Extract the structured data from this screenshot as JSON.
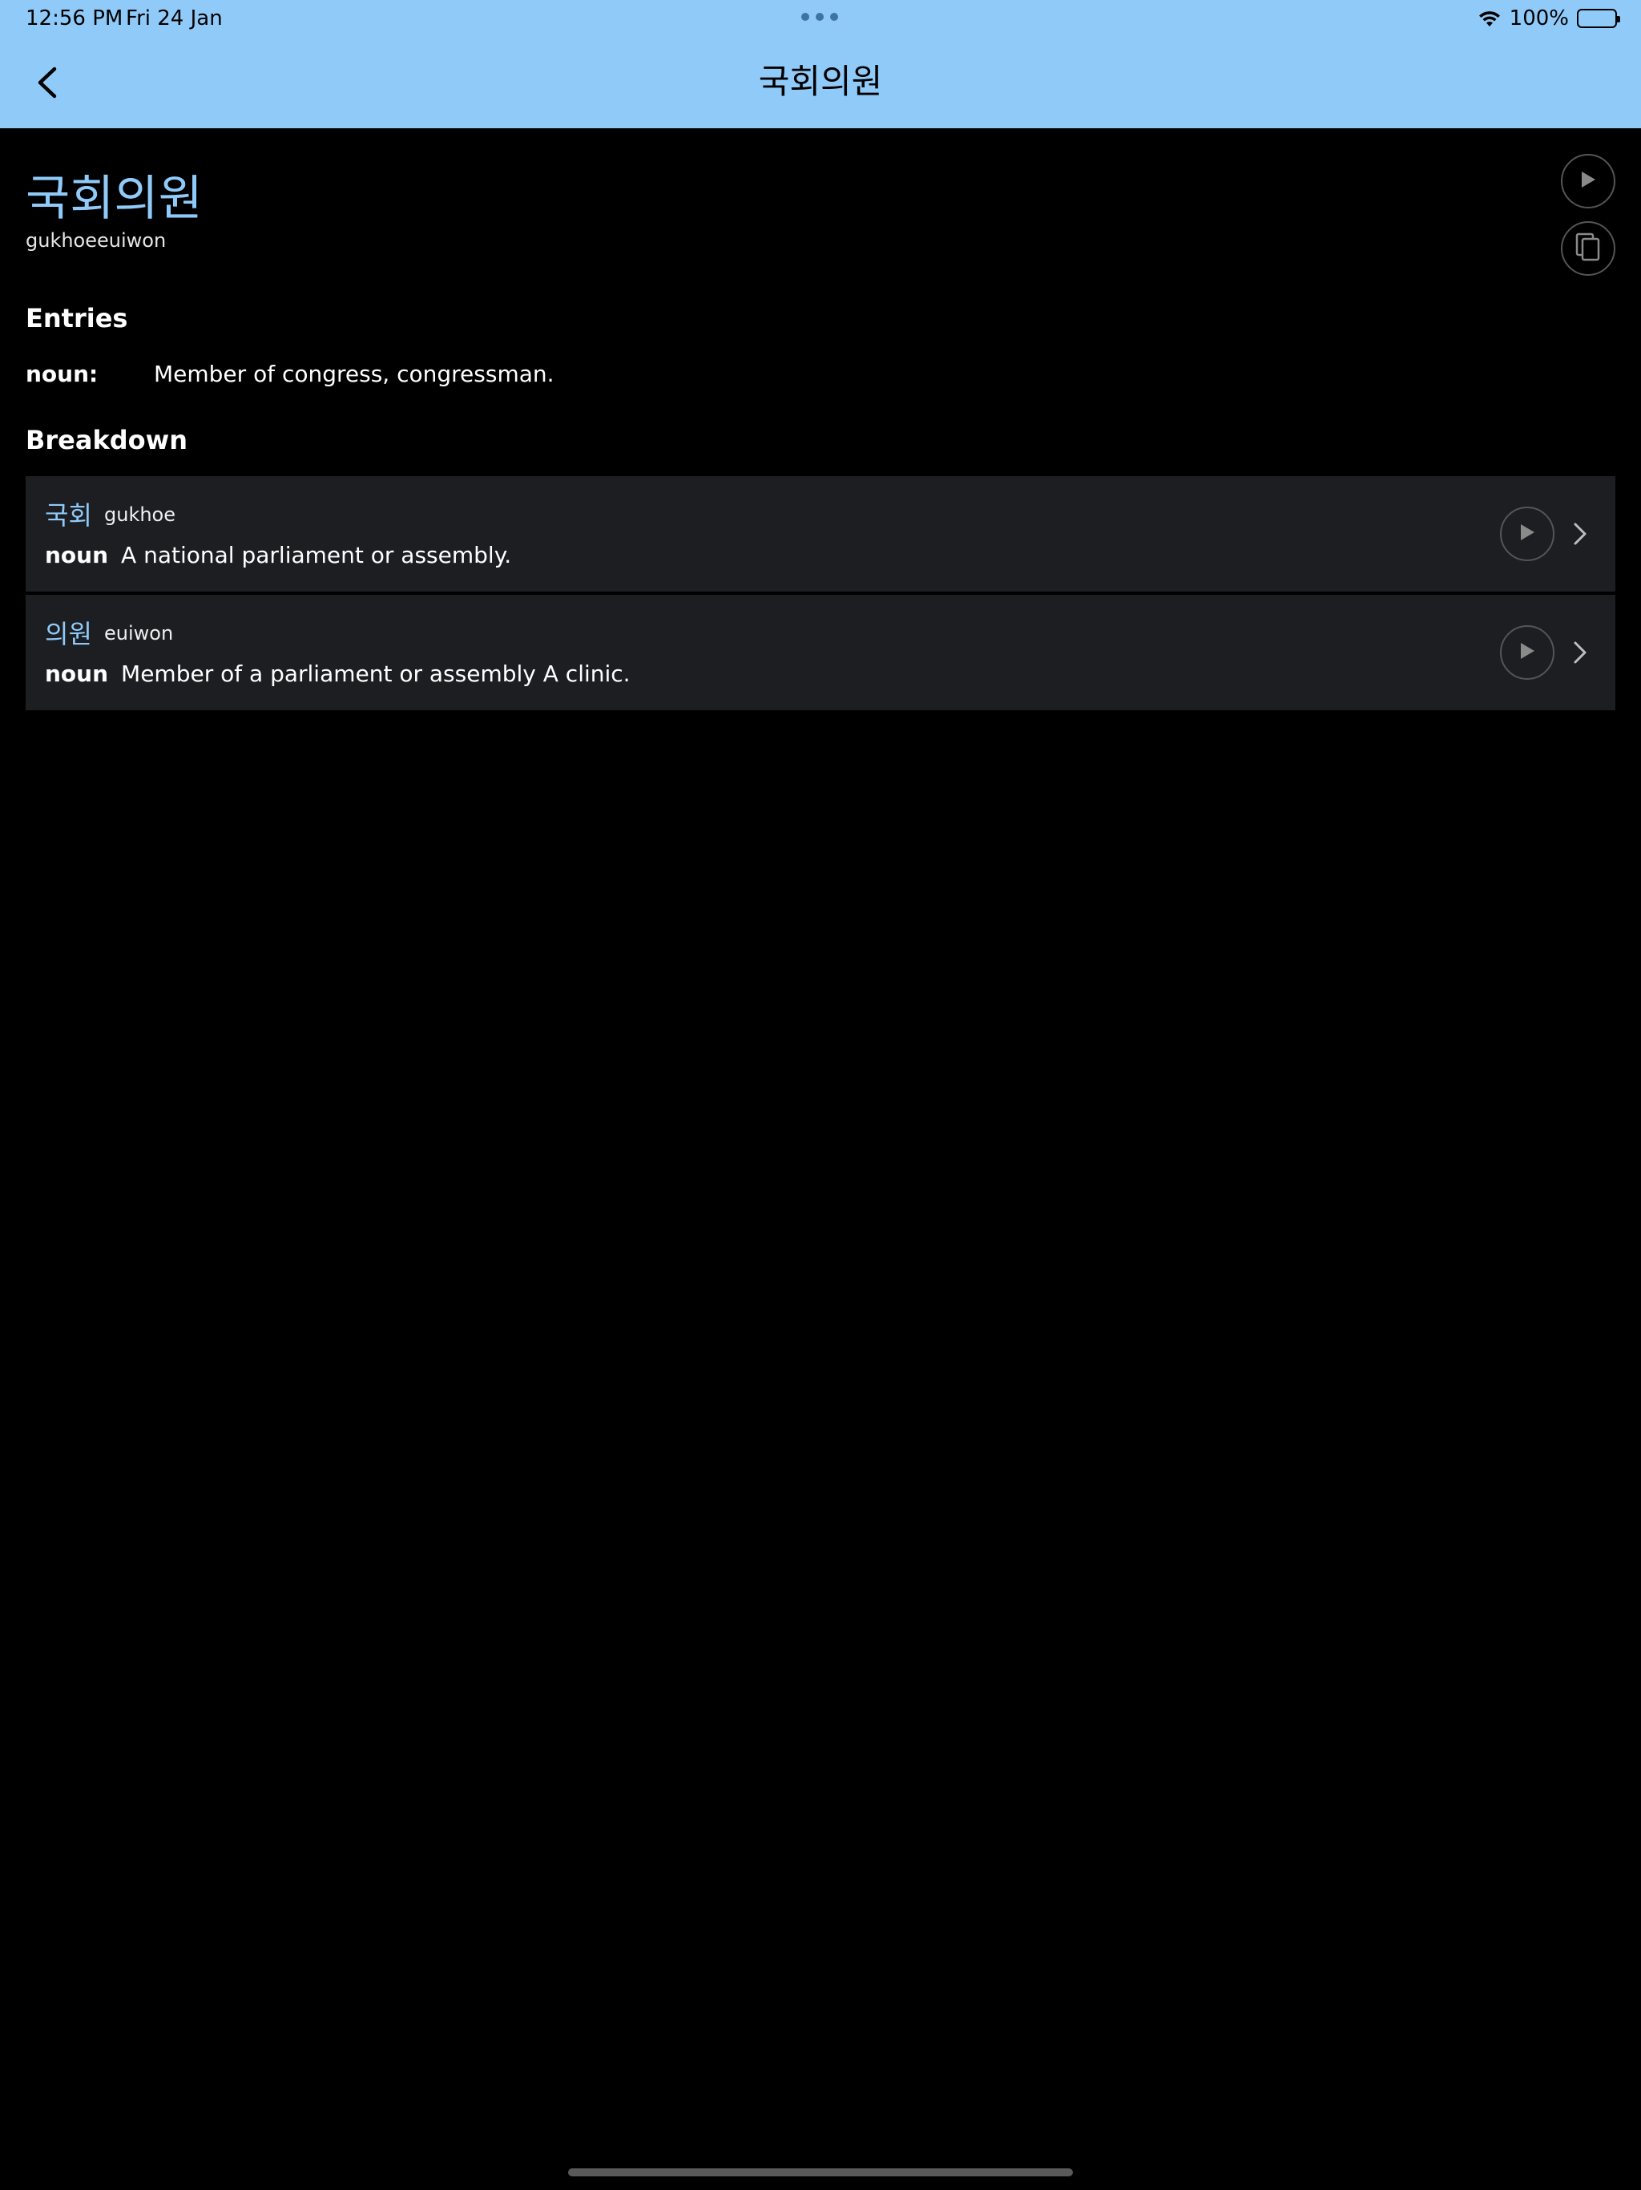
{
  "status_bar": {
    "time": "12:56 PM",
    "date": "Fri 24 Jan",
    "battery": "100%"
  },
  "nav": {
    "title": "국회의원"
  },
  "word": {
    "korean": "국회의원",
    "romanization": "gukhoeeuiwon"
  },
  "entries": {
    "heading": "Entries",
    "items": [
      {
        "pos": "noun:",
        "definition": "Member of congress, congressman."
      }
    ]
  },
  "breakdown": {
    "heading": "Breakdown",
    "items": [
      {
        "korean": "국회",
        "romanization": "gukhoe",
        "pos": "noun",
        "definition": "A national parliament or assembly."
      },
      {
        "korean": "의원",
        "romanization": "euiwon",
        "pos": "noun",
        "definition": "Member of a parliament or assembly A clinic."
      }
    ]
  },
  "colors": {
    "header_bg": "#90CAF9",
    "accent": "#90CAF9",
    "card_bg": "#1c1e22"
  },
  "icons": [
    "back-chevron-icon",
    "wifi-icon",
    "battery-icon",
    "play-icon",
    "copy-icon",
    "chevron-right-icon"
  ]
}
